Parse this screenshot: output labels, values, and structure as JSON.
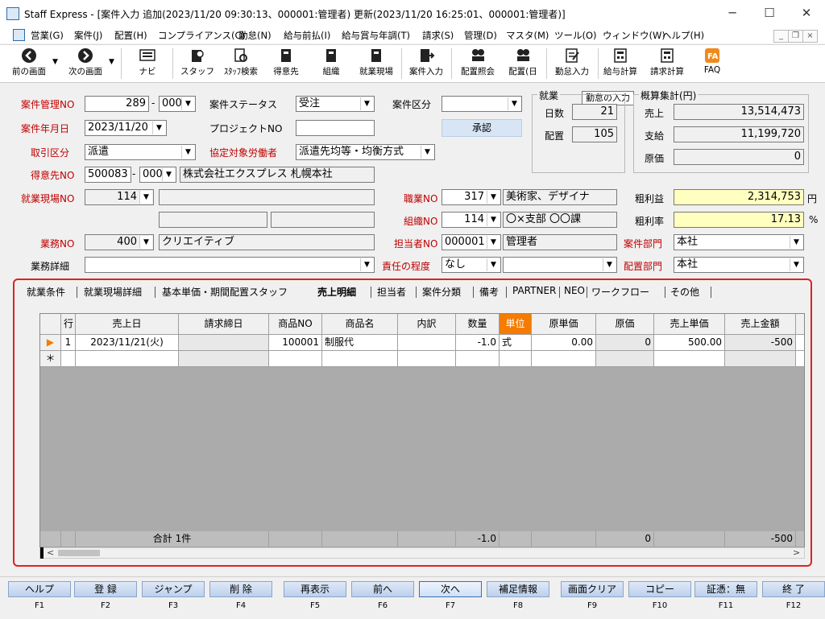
{
  "window": {
    "title": "Staff Express - [案件入力 追加(2023/11/20 09:30:13、000001:管理者) 更新(2023/11/20 16:25:01、000001:管理者)]",
    "minimize": "─",
    "maximize": "☐",
    "close": "✕"
  },
  "menu": [
    "営業(G)",
    "案件(J)",
    "配置(H)",
    "コンプライアンス(C)",
    "勤怠(N)",
    "給与前払(I)",
    "給与賞与年調(T)",
    "請求(S)",
    "管理(D)",
    "マスタ(M)",
    "ツール(O)",
    "ウィンドウ(W)",
    "ヘルプ(H)"
  ],
  "mdi": {
    "min": "_",
    "restore": "❐",
    "close": "×"
  },
  "toolbar": {
    "back": "前の画面",
    "next": "次の画面",
    "navi": "ナビ",
    "staff": "スタッフ",
    "staff_search": "ｽﾀｯﾌ検索",
    "client": "得意先",
    "org": "組織",
    "site": "就業現場",
    "case_input": "案件入力",
    "assign_ref": "配置照会",
    "assign_day": "配置(日",
    "attendance": "勤怠入力",
    "payroll_calc": "給与計算",
    "billing_calc": "請求計算",
    "faq": "FAQ",
    "tooltip": "勤怠の入力"
  },
  "form": {
    "case_no_label": "案件管理NO",
    "case_no": "289",
    "case_no_dash": "-",
    "case_no_sub": "000",
    "status_label": "案件ステータス",
    "status": "受注",
    "category_label": "案件区分",
    "category": "",
    "ym_label": "案件年月日",
    "ym": "2023/11/20",
    "project_label": "プロジェクトNO",
    "project": "",
    "approve": "承認",
    "trade_label": "取引区分",
    "trade": "派遣",
    "agreement_label": "協定対象労働者",
    "agreement": "派遣先均等・均衡方式",
    "client_label": "得意先NO",
    "client_no": "500083",
    "client_sub": "000",
    "client_name": "株式会社エクスプレス 札幌本社",
    "site_label": "就業現場NO",
    "site_no": "114",
    "job_label": "職業NO",
    "job_no": "317",
    "job_name": "美術家、デザイナ",
    "org_label": "組織NO",
    "org_no": "114",
    "org_name": "〇×支部 〇〇課",
    "biz_label": "業務NO",
    "biz_no": "400",
    "biz_name": "クリエイティブ",
    "person_label": "担当者NO",
    "person_no": "000001",
    "person_name": "管理者",
    "detail_label": "業務詳細",
    "detail": "",
    "resp_label": "責任の程度",
    "resp": "なし",
    "resp2": "",
    "dept_label": "案件部門",
    "dept": "本社",
    "place_dept_label": "配置部門",
    "place_dept": "本社",
    "gross_label": "粗利益",
    "gross": "2,314,753",
    "gross_unit": "円",
    "rate_label": "粗利率",
    "rate": "17.13",
    "rate_unit": "%"
  },
  "work": {
    "title": "就業",
    "days_label": "日数",
    "days": "21",
    "assign_label": "配置",
    "assign": "105"
  },
  "summary": {
    "title": "概算集計(円)",
    "sales_label": "売上",
    "sales": "13,514,473",
    "pay_label": "支給",
    "pay": "11,199,720",
    "cost_label": "原価",
    "cost": "0"
  },
  "tabs": [
    "就業条件",
    "就業現場詳細",
    "基本単価・期間配置スタッフ",
    "売上明細",
    "担当者",
    "案件分類",
    "備考",
    "PARTNER",
    "NEO",
    "ワークフロー",
    "その他"
  ],
  "grid": {
    "headers": [
      "行",
      "売上日",
      "請求締日",
      "商品NO",
      "商品名",
      "内訳",
      "数量",
      "単位",
      "原単価",
      "原価",
      "売上単価",
      "売上金額"
    ],
    "row": [
      "1",
      "2023/11/21(火)",
      "",
      "100001",
      "制服代",
      "",
      "-1.0",
      "式",
      "0.00",
      "0",
      "500.00",
      "-500"
    ],
    "new_row_marker": "＊",
    "current_marker": "▶",
    "total_label": "合計 1件",
    "total_qty": "-1.0",
    "total_cost": "0",
    "total_sales": "-500"
  },
  "fkeys": [
    {
      "label": "ヘルプ",
      "key": "F1"
    },
    {
      "label": "登 録",
      "key": "F2"
    },
    {
      "label": "ジャンプ",
      "key": "F3"
    },
    {
      "label": "削 除",
      "key": "F4"
    },
    {
      "label": "再表示",
      "key": "F5"
    },
    {
      "label": "前へ",
      "key": "F6"
    },
    {
      "label": "次へ",
      "key": "F7"
    },
    {
      "label": "補足情報",
      "key": "F8"
    },
    {
      "label": "画面クリア",
      "key": "F9"
    },
    {
      "label": "コピー",
      "key": "F10"
    },
    {
      "label": "証憑：無",
      "key": "F11"
    },
    {
      "label": "終 了",
      "key": "F12"
    }
  ]
}
